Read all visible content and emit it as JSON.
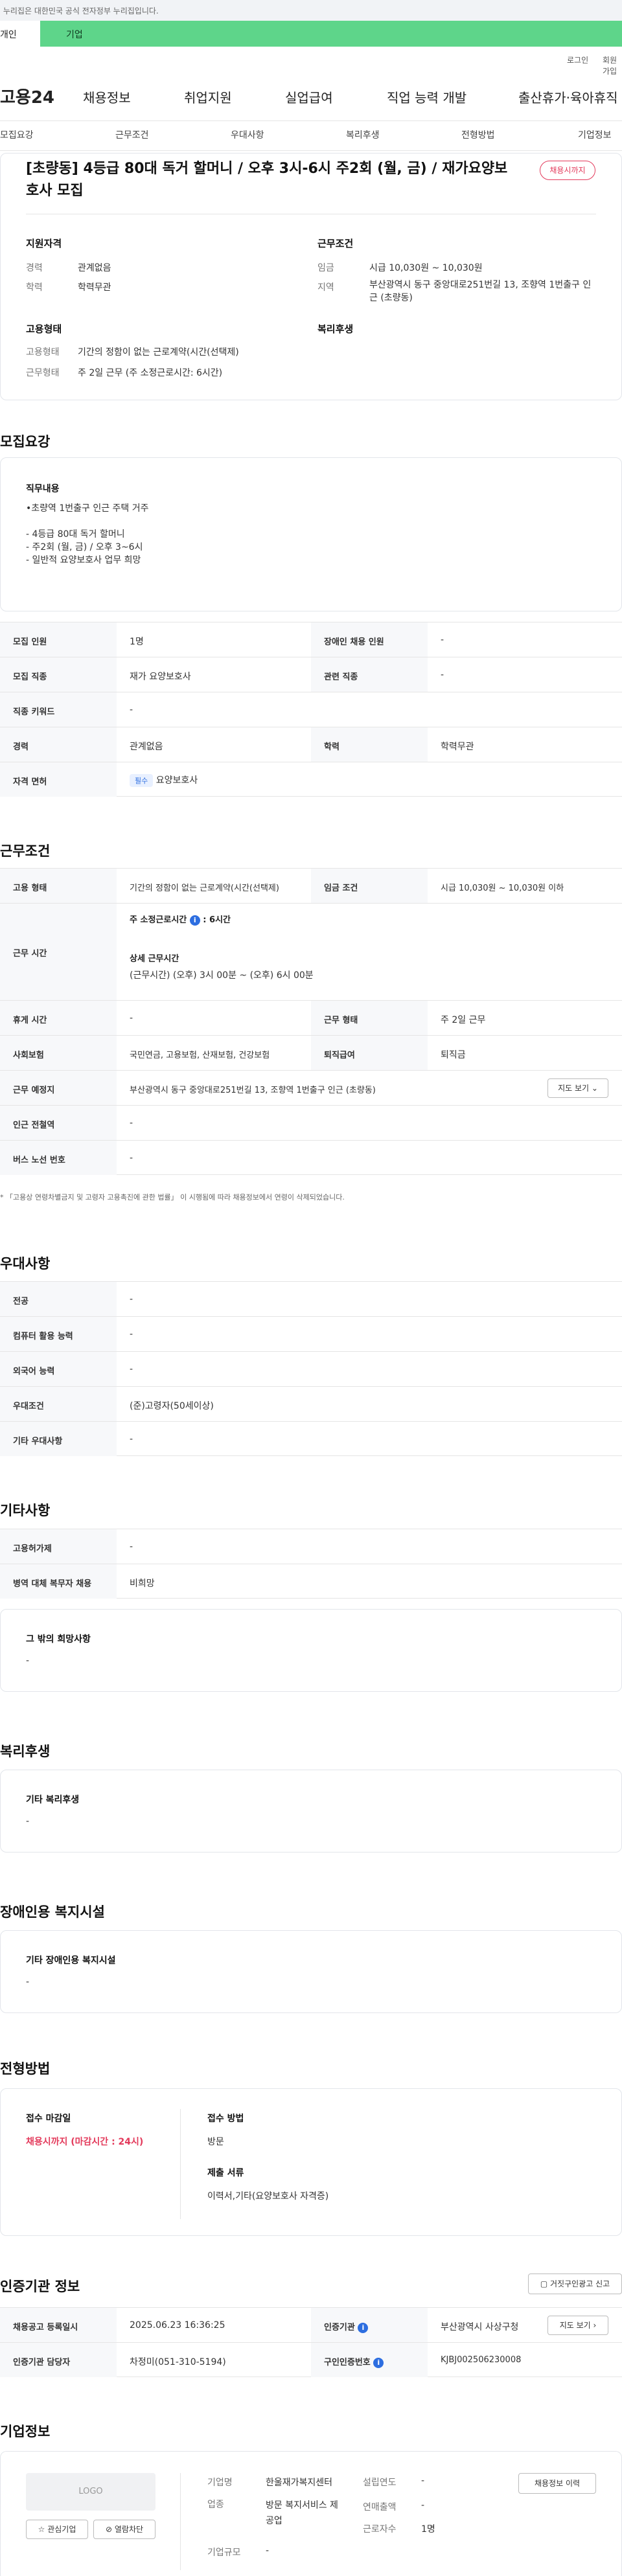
{
  "gov_banner": "이 누리집은 대한민국 공식 전자정부 누리집입니다.",
  "top_tabs": {
    "personal": "개인",
    "company": "기업"
  },
  "util": {
    "login": "로그인",
    "join": "회원가입"
  },
  "logo": "고용24",
  "gnb": [
    "채용정보",
    "취업지원",
    "실업급여",
    "직업 능력 개발",
    "출산휴가·육아휴직"
  ],
  "anchors": [
    "모집요강",
    "근무조건",
    "우대사항",
    "복리후생",
    "전형방법",
    "기업정보"
  ],
  "summary": {
    "title": "[초량동] 4등급 80대 독거 할머니 / 오후 3시-6시 주2회 (월, 금) / 재가요양보호사 모집",
    "badge": "채용시까지",
    "qual_title": "지원자격",
    "career_label": "경력",
    "career": "관계없음",
    "edu_label": "학력",
    "edu": "학력무관",
    "cond_title": "근무조건",
    "wage_label": "임금",
    "wage": "시급 10,030원 ~ 10,030원",
    "region_label": "지역",
    "region": "부산광역시 동구 중앙대로251번길 13, 조향역 1번출구 인근 (초량동)",
    "emp_title": "고용형태",
    "emptype_label": "고용형태",
    "emptype": "기간의 정함이 없는 근로계약(시간(선택제)",
    "worktype_label": "근무형태",
    "worktype": "주 2일 근무 (주 소정근로시간: 6시간)",
    "welfare_title": "복리후생"
  },
  "recruit": {
    "heading": "모집요강",
    "duty_title": "직무내용",
    "duty_lines": [
      "•초량역 1번출구 인근 주택 거주",
      "",
      "- 4등급 80대 독거 할머니",
      "- 주2회 (월, 금) / 오후 3~6시",
      "- 일반적 요양보호사 업무 희망"
    ],
    "rows": [
      {
        "l1": "모집 인원",
        "v1": "1명",
        "l2": "장애인 채용 인원",
        "v2": "-"
      },
      {
        "l1": "모집 직종",
        "v1": "재가 요양보호사",
        "l2": "관련 직종",
        "v2": "-"
      },
      {
        "l1": "직종 키워드",
        "v1": "-"
      },
      {
        "l1": "경력",
        "v1": "관계없음",
        "l2": "학력",
        "v2": "학력무관"
      },
      {
        "l1": "자격 면허",
        "cert_badge": "필수",
        "v1": "요양보호사"
      }
    ]
  },
  "work": {
    "heading": "근무조건",
    "emp_label": "고용 형태",
    "emp": "기간의 정함이 없는 근로계약(시간(선택제)",
    "wage_label": "임금 조건",
    "wage": "시급 10,030원 ~ 10,030원 이하",
    "hours_label": "근무 시간",
    "hours_week": "주 소정근로시간",
    "hours_week_val": "6시간",
    "hours_detail_title": "상세 근무시간",
    "hours_detail": "(근무시간) (오후) 3시 00분 ~ (오후) 6시 00분",
    "break_label": "휴게 시간",
    "break": "-",
    "worktype_label": "근무 형태",
    "worktype": "주 2일 근무",
    "insurance_label": "사회보험",
    "insurance": "국민연금, 고용보험, 산재보험, 건강보험",
    "retire_label": "퇴직급여",
    "retire": "퇴직금",
    "place_label": "근무 예정지",
    "place": "부산광역시 동구 중앙대로251번길 13, 조향역 1번출구 인근 (초량동)",
    "map_btn": "지도 보기",
    "subway_label": "인근 전철역",
    "subway": "-",
    "bus_label": "버스 노선 번호",
    "bus": "-",
    "note": "* 「고용상 연령차별금지 및 고령자 고용촉진에 관한 법률」 이 시행됨에 따라 채용정보에서 연령이 삭제되었습니다."
  },
  "pref": {
    "heading": "우대사항",
    "rows": [
      {
        "l": "전공",
        "v": "-"
      },
      {
        "l": "컴퓨터 활용 능력",
        "v": "-"
      },
      {
        "l": "외국어 능력",
        "v": "-"
      },
      {
        "l": "우대조건",
        "v": "(준)고령자(50세이상)"
      },
      {
        "l": "기타 우대사항",
        "v": "-"
      }
    ]
  },
  "etc": {
    "heading": "기타사항",
    "rows": [
      {
        "l": "고용허가제",
        "v": "-"
      },
      {
        "l": "병역 대체 복무자 채용",
        "v": "비희망"
      }
    ],
    "other_title": "그 밖의 희망사항",
    "other": "-"
  },
  "welfare": {
    "heading": "복리후생",
    "title": "기타 복리후생",
    "val": "-"
  },
  "disabled": {
    "heading": "장애인용 복지시설",
    "title": "기타 장애인용 복지시설",
    "val": "-"
  },
  "process": {
    "heading": "전형방법",
    "deadline_title": "접수 마감일",
    "deadline": "채용시까지 (마감시간 : 24시)",
    "method_title": "접수 방법",
    "method": "방문",
    "docs_title": "제출 서류",
    "docs": "이력서,기타(요양보호사 자격증)"
  },
  "agency": {
    "heading": "인증기관 정보",
    "report_btn": "거짓구인광고 신고",
    "reg_label": "채용공고 등록일시",
    "reg": "2025.06.23 16:36:25",
    "agency_label": "인증기관",
    "agency": "부산광역시 사상구청",
    "map_btn": "지도 보기",
    "mgr_label": "인증기관 담당자",
    "mgr": "차정미(051-310-5194)",
    "num_label": "구인인증번호",
    "num": "KJBJ002506230008"
  },
  "company": {
    "heading": "기업정보",
    "logo": "LOGO",
    "fav": "관심기업",
    "block": "열람차단",
    "name_label": "기업명",
    "name": "한울재가복지센터",
    "year_label": "설립연도",
    "year": "-",
    "biz_label": "업종",
    "biz": "방문 복지서비스 제공업",
    "sales_label": "연매출액",
    "sales": "-",
    "emp_label": "근로자수",
    "emp": "1명",
    "size_label": "기업규모",
    "size": "-",
    "history_btn": "채용정보 이력"
  }
}
